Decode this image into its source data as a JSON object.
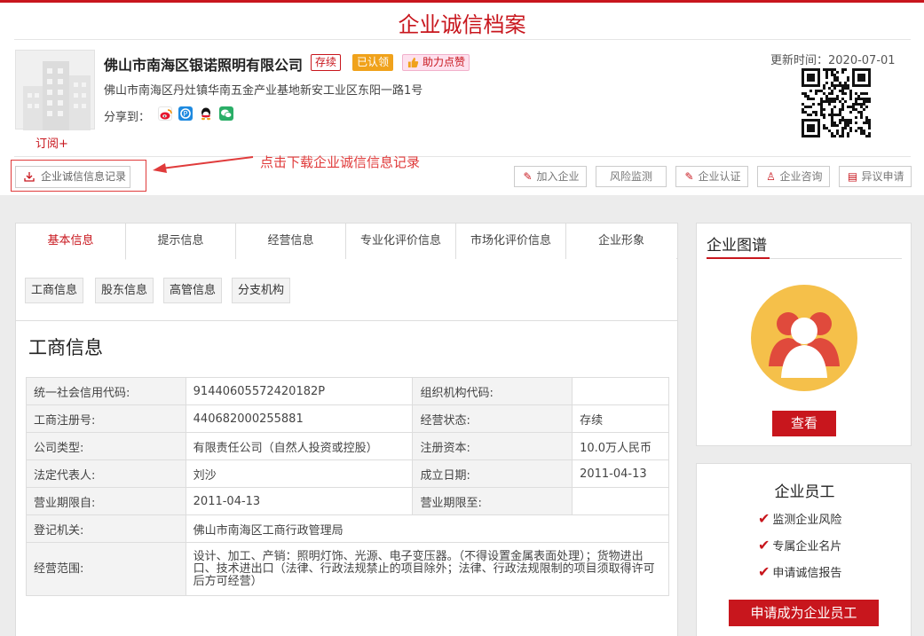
{
  "page": {
    "title": "企业诚信档案"
  },
  "company": {
    "name": "佛山市南海区银诺照明有限公司",
    "badges": {
      "status": "存续",
      "claimed": "已认领",
      "like": "助力点赞"
    },
    "address": "佛山市南海区丹灶镇华南五金产业基地新安工业区东阳一路1号",
    "share_label": "分享到：",
    "share_icons": [
      "weibo-icon",
      "qzone-icon",
      "qq-icon",
      "wechat-icon"
    ],
    "subscribe": "订阅+",
    "update_time": "更新时间：2020-07-01"
  },
  "toolbar": {
    "download_label": "企业诚信信息记录",
    "annotation": "点击下载企业诚信信息记录",
    "actions": [
      {
        "label": "加入企业",
        "icon": "pencil-icon"
      },
      {
        "label": "风险监测",
        "icon": ""
      },
      {
        "label": "企业认证",
        "icon": "pencil-icon"
      },
      {
        "label": "企业咨询",
        "icon": "user-icon"
      },
      {
        "label": "异议申请",
        "icon": "document-icon"
      }
    ]
  },
  "tabs": [
    "基本信息",
    "提示信息",
    "经营信息",
    "专业化评价信息",
    "市场化评价信息",
    "企业形象"
  ],
  "subtabs": [
    "工商信息",
    "股东信息",
    "高管信息",
    "分支机构"
  ],
  "section": {
    "title": "工商信息",
    "rows": [
      {
        "l1": "统一社会信用代码:",
        "v1": "91440605572420182P",
        "l2": "组织机构代码:",
        "v2": ""
      },
      {
        "l1": "工商注册号:",
        "v1": "440682000255881",
        "l2": "经营状态:",
        "v2": "存续"
      },
      {
        "l1": "公司类型:",
        "v1": "有限责任公司（自然人投资或控股）",
        "l2": "注册资本:",
        "v2": "10.0万人民币"
      },
      {
        "l1": "法定代表人:",
        "v1": "刘沙",
        "l2": "成立日期:",
        "v2": "2011-04-13"
      },
      {
        "l1": "营业期限自:",
        "v1": "2011-04-13",
        "l2": "营业期限至:",
        "v2": ""
      }
    ],
    "authority_label": "登记机关:",
    "authority_value": "佛山市南海区工商行政管理局",
    "scope_label": "经营范围:",
    "scope_value": "设计、加工、产销：照明灯饰、光源、电子变压器。（不得设置金属表面处理）；货物进出口、技术进出口（法律、行政法规禁止的项目除外；法律、行政法规限制的项目须取得许可后方可经营）"
  },
  "sidebar": {
    "graph_title": "企业图谱",
    "view_button": "查看",
    "staff_title": "企业员工",
    "features": [
      "监测企业风险",
      "专属企业名片",
      "申请诚信报告"
    ],
    "apply_button": "申请成为企业员工"
  },
  "colors": {
    "brand_red": "#c8161d",
    "badge_orange": "#f0a21b",
    "like_pink": "#fde1ee",
    "graph_yellow": "#f5c04a"
  }
}
